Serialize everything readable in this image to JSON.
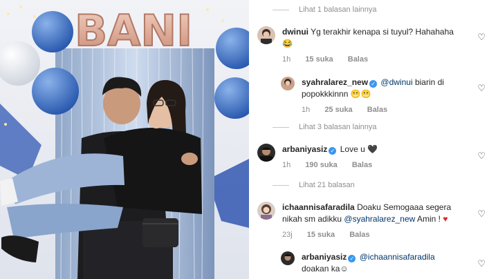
{
  "photo": {
    "balloon_text": "BANI",
    "alt": "Couple photo with balloons"
  },
  "comments_panel": {
    "view_more_1": "Lihat 1 balasan lainnya",
    "comments": [
      {
        "username": "dwinui",
        "text": "Yg terakhir kenapa si tuyul? Hahahaha",
        "emoji": "😂",
        "time": "1h",
        "likes": "15 suka",
        "reply": "Balas"
      },
      {
        "username": "syahralarez_new",
        "mention": "@dwinui",
        "text": " biarin di popokkkinnn",
        "emoji": "😬😬",
        "time": "1h",
        "likes": "25 suka",
        "reply": "Balas"
      }
    ],
    "view_more_2": "Lihat 3 balasan lainnya",
    "comment3": {
      "username": "arbaniyasiz",
      "text": "Love u",
      "emoji": "🖤",
      "time": "1h",
      "likes": "190 suka",
      "reply": "Balas"
    },
    "view_more_3": "Lihat 21 balasan",
    "comment4": {
      "username": "ichaannisafaradila",
      "text": "Doaku Semogaaa segera nikah sm adikku",
      "mention": "@syahralarez_new",
      "text2": " Amin !",
      "emoji": "♥",
      "time": "23j",
      "likes": "15 suka",
      "reply": "Balas"
    },
    "comment5": {
      "username": "arbaniyasiz",
      "mention": "@ichaannisafaradila",
      "text": "doakan ka",
      "emoji": "☺"
    }
  },
  "colors": {
    "mention": "#003569",
    "verified": "#3897f0",
    "muted": "#8e8e8e"
  }
}
